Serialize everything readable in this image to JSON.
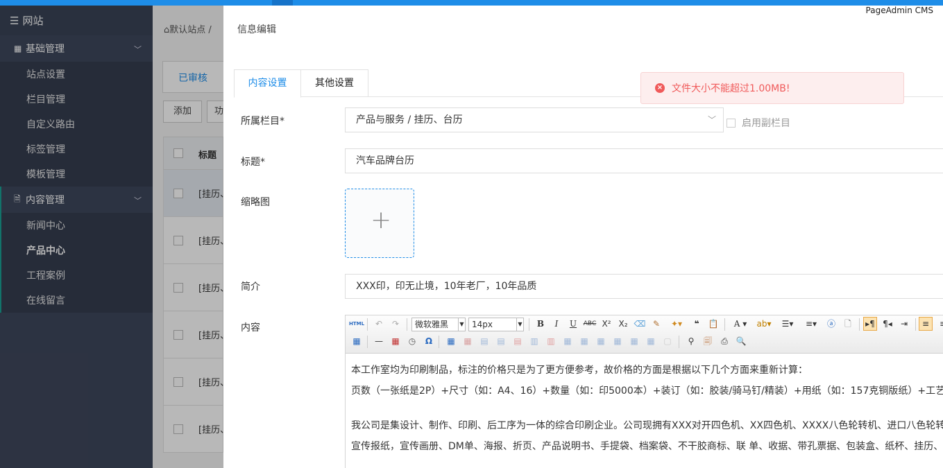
{
  "brand": "PageAdmin CMS",
  "sidebar": {
    "header": "网站",
    "groups": [
      {
        "label": "基础管理",
        "items": [
          "站点设置",
          "栏目管理",
          "自定义路由",
          "标签管理",
          "模板管理"
        ]
      },
      {
        "label": "内容管理",
        "items": [
          "新闻中心",
          "产品中心",
          "工程案例",
          "在线留言"
        ],
        "active": "产品中心"
      }
    ]
  },
  "background": {
    "breadcrumb": "默认站点 /",
    "tab": "已审核",
    "add_button": "添加",
    "more_button": "功",
    "column_title": "标题",
    "rows": [
      "[挂历、",
      "[挂历、",
      "[挂历、",
      "[挂历、",
      "[挂历、",
      "[挂历、"
    ]
  },
  "panel": {
    "title": "信息编辑",
    "tabs": [
      "内容设置",
      "其他设置"
    ],
    "toast": "文件大小不能超过1.00MB!",
    "fields": {
      "category_label": "所属栏目*",
      "category_value": "产品与服务 / 挂历、台历",
      "sub_category_label": "启用副栏目",
      "title_label": "标题*",
      "title_value": "汽车品牌台历",
      "thumb_label": "缩略图",
      "summary_label": "简介",
      "summary_value": "XXX印，印无止境，10年老厂，10年品质",
      "content_label": "内容"
    },
    "editor": {
      "font_family": "微软雅黑",
      "font_size": "14px",
      "html_btn": "HTML",
      "paragraphs": [
        "本工作室均为印刷制品，标注的价格只是为了更方便参考，故价格的方面是根据以下几个方面来重新计算：",
        "页数（一张纸是2P）+尺寸（如：A4、16）+数量（如：印5000本）+装订（如：胶装/骑马钉/精装）+用纸（如：157克铜版纸）+工艺",
        "我公司是集设计、制作、印刷、后工序为一体的综合印刷企业。公司现拥有XXX对开四色机、XX四色机、XXXX八色轮转机、进口八色轮转",
        "宣传报纸，宣传画册、DM单、海报、折页、产品说明书、手提袋、档案袋、不干胶商标、联 单、收据、带孔票据、包装盒、纸杯、挂历、"
      ]
    }
  },
  "colors": {
    "accent": "#1e8de8",
    "sidebar": "#3e475c",
    "error": "#f05a5a"
  }
}
